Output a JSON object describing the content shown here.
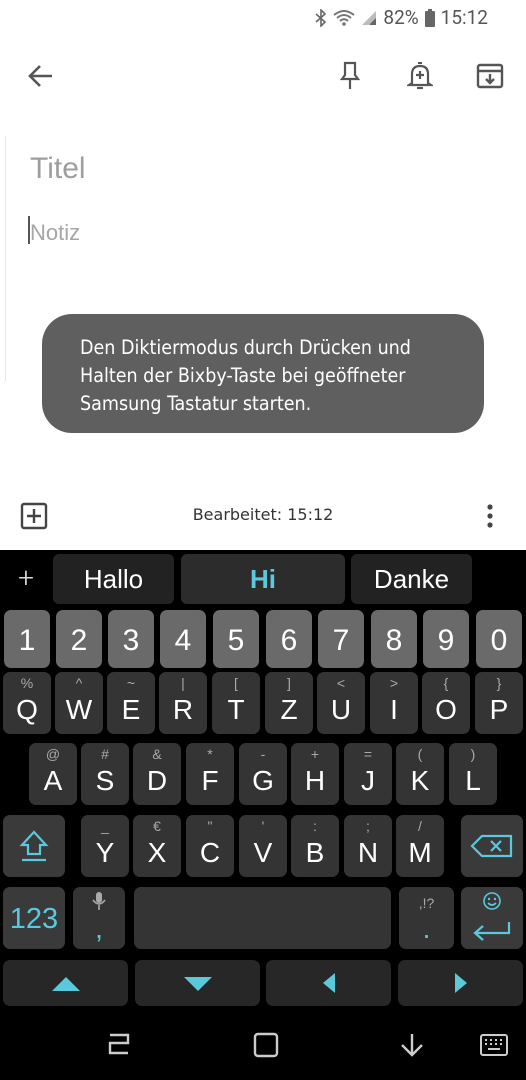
{
  "status_bar": {
    "battery": "82%",
    "time": "15:12"
  },
  "note": {
    "title_placeholder": "Titel",
    "body_placeholder": "Notiz"
  },
  "toast": {
    "lines": [
      "Den Diktiermodus durch Drücken und",
      "Halten der Bixby-Taste bei geöffneter",
      "Samsung Tastatur starten."
    ]
  },
  "bottom": {
    "edited": "Bearbeitet: 15:12"
  },
  "keyboard": {
    "suggestions": [
      "Hallo",
      "Hi",
      "Danke"
    ],
    "suggest_plus": "+",
    "numbers": [
      "1",
      "2",
      "3",
      "4",
      "5",
      "6",
      "7",
      "8",
      "9",
      "0"
    ],
    "row1": [
      {
        "main": "Q",
        "sub": "%"
      },
      {
        "main": "W",
        "sub": "^"
      },
      {
        "main": "E",
        "sub": "~"
      },
      {
        "main": "R",
        "sub": "|"
      },
      {
        "main": "T",
        "sub": "["
      },
      {
        "main": "Z",
        "sub": "]"
      },
      {
        "main": "U",
        "sub": "<"
      },
      {
        "main": "I",
        "sub": ">"
      },
      {
        "main": "O",
        "sub": "{"
      },
      {
        "main": "P",
        "sub": "}"
      }
    ],
    "row2": [
      {
        "main": "A",
        "sub": "@"
      },
      {
        "main": "S",
        "sub": "#"
      },
      {
        "main": "D",
        "sub": "&"
      },
      {
        "main": "F",
        "sub": "*"
      },
      {
        "main": "G",
        "sub": "-"
      },
      {
        "main": "H",
        "sub": "+"
      },
      {
        "main": "J",
        "sub": "="
      },
      {
        "main": "K",
        "sub": "("
      },
      {
        "main": "L",
        "sub": ")"
      }
    ],
    "row3": [
      {
        "main": "Y",
        "sub": "_"
      },
      {
        "main": "X",
        "sub": "€"
      },
      {
        "main": "C",
        "sub": "\""
      },
      {
        "main": "V",
        "sub": "'"
      },
      {
        "main": "B",
        "sub": ":"
      },
      {
        "main": "N",
        "sub": ";"
      },
      {
        "main": "M",
        "sub": "/"
      }
    ],
    "symbols_key": "123",
    "comma_key": ",",
    "period_key": ".",
    "period_sub": ",!?",
    "accent_color": "#5bc8dc"
  }
}
